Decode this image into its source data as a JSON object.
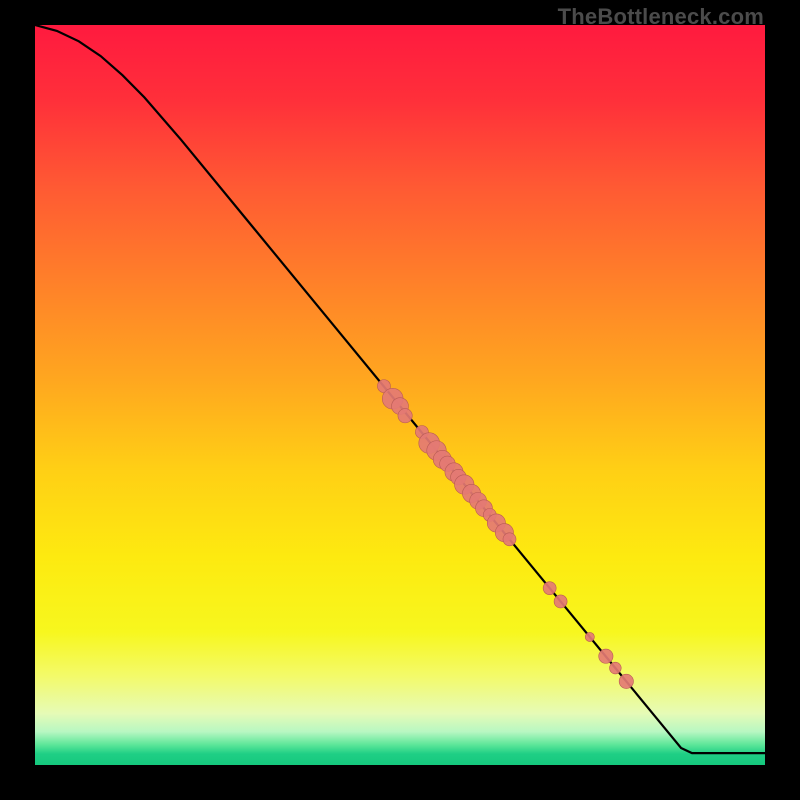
{
  "watermark": "TheBottleneck.com",
  "colors": {
    "gradient_stops": [
      {
        "offset": 0.0,
        "color": "#ff1a3f"
      },
      {
        "offset": 0.1,
        "color": "#ff2f3a"
      },
      {
        "offset": 0.22,
        "color": "#ff5a33"
      },
      {
        "offset": 0.35,
        "color": "#ff8129"
      },
      {
        "offset": 0.48,
        "color": "#ffa71f"
      },
      {
        "offset": 0.6,
        "color": "#ffcf15"
      },
      {
        "offset": 0.72,
        "color": "#fdea10"
      },
      {
        "offset": 0.82,
        "color": "#f7f71e"
      },
      {
        "offset": 0.88,
        "color": "#f3fa6a"
      },
      {
        "offset": 0.93,
        "color": "#e6fbb6"
      },
      {
        "offset": 0.955,
        "color": "#b8f7c2"
      },
      {
        "offset": 0.972,
        "color": "#5fe79a"
      },
      {
        "offset": 0.985,
        "color": "#1fcf85"
      },
      {
        "offset": 1.0,
        "color": "#15c87d"
      }
    ],
    "curve": "#000000",
    "point_fill": "#e47a74",
    "point_stroke": "#b85a55"
  },
  "chart_data": {
    "type": "line",
    "title": "",
    "xlabel": "",
    "ylabel": "",
    "xlim": [
      0,
      100
    ],
    "ylim": [
      0,
      100
    ],
    "curve": [
      {
        "x": 0.0,
        "y": 100.0
      },
      {
        "x": 3.0,
        "y": 99.2
      },
      {
        "x": 6.0,
        "y": 97.8
      },
      {
        "x": 9.0,
        "y": 95.8
      },
      {
        "x": 12.0,
        "y": 93.2
      },
      {
        "x": 15.0,
        "y": 90.2
      },
      {
        "x": 20.0,
        "y": 84.5
      },
      {
        "x": 30.0,
        "y": 72.5
      },
      {
        "x": 40.0,
        "y": 60.5
      },
      {
        "x": 50.0,
        "y": 48.5
      },
      {
        "x": 55.0,
        "y": 42.5
      },
      {
        "x": 60.0,
        "y": 36.5
      },
      {
        "x": 65.0,
        "y": 30.5
      },
      {
        "x": 70.0,
        "y": 24.5
      },
      {
        "x": 75.0,
        "y": 18.5
      },
      {
        "x": 80.0,
        "y": 12.5
      },
      {
        "x": 85.0,
        "y": 6.5
      },
      {
        "x": 88.5,
        "y": 2.3
      },
      {
        "x": 90.0,
        "y": 1.6
      },
      {
        "x": 92.0,
        "y": 1.6
      },
      {
        "x": 95.0,
        "y": 1.6
      },
      {
        "x": 100.0,
        "y": 1.6
      }
    ],
    "series": [
      {
        "name": "points",
        "values": [
          {
            "x": 47.8,
            "y": 51.2,
            "r": 1.0
          },
          {
            "x": 49.0,
            "y": 49.5,
            "r": 1.6
          },
          {
            "x": 50.0,
            "y": 48.5,
            "r": 1.3
          },
          {
            "x": 50.7,
            "y": 47.2,
            "r": 1.1
          },
          {
            "x": 53.0,
            "y": 45.0,
            "r": 1.0
          },
          {
            "x": 54.0,
            "y": 43.5,
            "r": 1.6
          },
          {
            "x": 55.0,
            "y": 42.5,
            "r": 1.5
          },
          {
            "x": 55.8,
            "y": 41.3,
            "r": 1.4
          },
          {
            "x": 56.5,
            "y": 40.7,
            "r": 1.2
          },
          {
            "x": 57.4,
            "y": 39.6,
            "r": 1.4
          },
          {
            "x": 58.0,
            "y": 38.9,
            "r": 1.2
          },
          {
            "x": 58.8,
            "y": 37.9,
            "r": 1.5
          },
          {
            "x": 59.8,
            "y": 36.7,
            "r": 1.4
          },
          {
            "x": 60.7,
            "y": 35.7,
            "r": 1.3
          },
          {
            "x": 61.5,
            "y": 34.7,
            "r": 1.3
          },
          {
            "x": 62.3,
            "y": 33.8,
            "r": 1.0
          },
          {
            "x": 63.2,
            "y": 32.7,
            "r": 1.4
          },
          {
            "x": 64.3,
            "y": 31.4,
            "r": 1.4
          },
          {
            "x": 65.0,
            "y": 30.5,
            "r": 1.0
          },
          {
            "x": 70.5,
            "y": 23.9,
            "r": 1.0
          },
          {
            "x": 72.0,
            "y": 22.1,
            "r": 1.0
          },
          {
            "x": 76.0,
            "y": 17.3,
            "r": 0.7
          },
          {
            "x": 78.2,
            "y": 14.7,
            "r": 1.1
          },
          {
            "x": 79.5,
            "y": 13.1,
            "r": 0.9
          },
          {
            "x": 81.0,
            "y": 11.3,
            "r": 1.1
          }
        ]
      }
    ]
  }
}
